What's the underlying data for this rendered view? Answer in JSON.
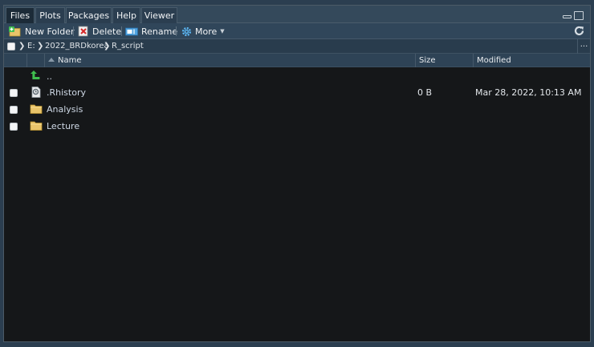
{
  "tabs": [
    {
      "label": "Files",
      "active": true
    },
    {
      "label": "Plots",
      "active": false
    },
    {
      "label": "Packages",
      "active": false
    },
    {
      "label": "Help",
      "active": false
    },
    {
      "label": "Viewer",
      "active": false
    }
  ],
  "toolbar": {
    "new_folder": "New Folder",
    "delete": "Delete",
    "rename": "Rename",
    "more": "More"
  },
  "breadcrumb": {
    "items": [
      "E:",
      "2022_BRDkorea",
      "R_script"
    ],
    "more": "..."
  },
  "table": {
    "columns": {
      "name": "Name",
      "size": "Size",
      "modified": "Modified"
    },
    "up_label": "..",
    "rows": [
      {
        "name": ".Rhistory",
        "size": "0 B",
        "modified": "Mar 28, 2022, 10:13 AM",
        "type": "file-icon"
      },
      {
        "name": "Analysis",
        "size": "",
        "modified": "",
        "type": "folder-icon"
      },
      {
        "name": "Lecture",
        "size": "",
        "modified": "",
        "type": "folder-icon"
      }
    ]
  },
  "colors": {
    "background": "#2b3e50",
    "pane": "#151719",
    "tab_active": "#1c2b38",
    "folder": "#e9c46a",
    "up_arrow": "#3fbf4f"
  }
}
